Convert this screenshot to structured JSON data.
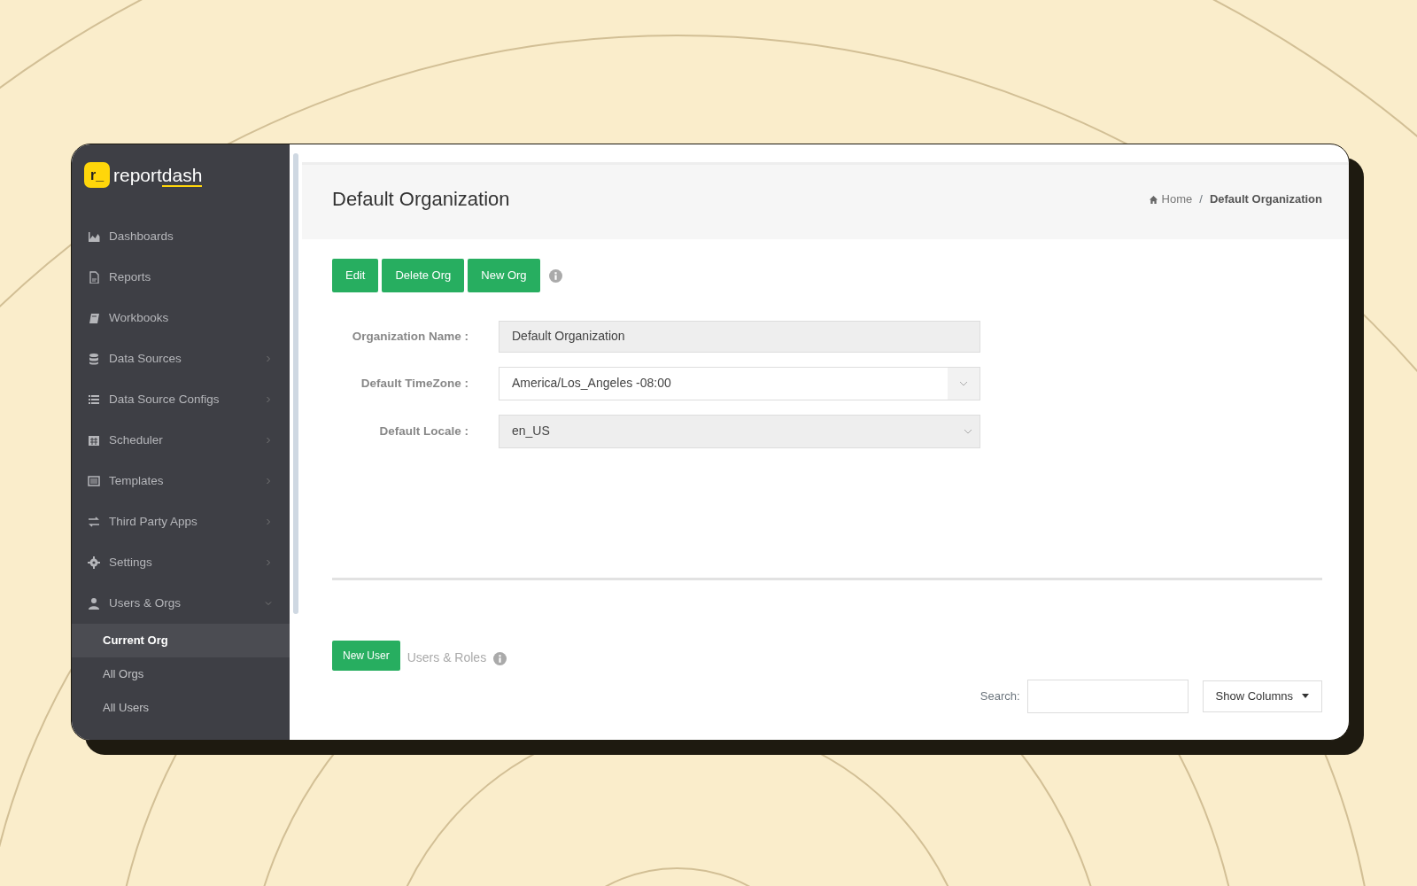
{
  "brand": {
    "mark": "r_",
    "name_start": "report",
    "name_end": "dash"
  },
  "sidebar": {
    "items": [
      {
        "label": "Dashboards",
        "kind": "link"
      },
      {
        "label": "Reports",
        "kind": "link"
      },
      {
        "label": "Workbooks",
        "kind": "link"
      },
      {
        "label": "Data Sources",
        "kind": "submenu",
        "expanded": false
      },
      {
        "label": "Data Source Configs",
        "kind": "submenu",
        "expanded": false
      },
      {
        "label": "Scheduler",
        "kind": "submenu",
        "expanded": false
      },
      {
        "label": "Templates",
        "kind": "submenu",
        "expanded": false
      },
      {
        "label": "Third Party Apps",
        "kind": "submenu",
        "expanded": false
      },
      {
        "label": "Settings",
        "kind": "submenu",
        "expanded": false
      },
      {
        "label": "Users & Orgs",
        "kind": "submenu",
        "expanded": true,
        "children": [
          {
            "label": "Current Org",
            "selected": true
          },
          {
            "label": "All Orgs",
            "selected": false
          },
          {
            "label": "All Users",
            "selected": false
          }
        ]
      }
    ]
  },
  "page": {
    "title": "Default Organization",
    "separator": "/",
    "breadcrumb": [
      {
        "label": "Home",
        "current": false
      },
      {
        "label": "Default Organization",
        "current": true
      }
    ]
  },
  "actions": [
    "Edit",
    "Delete Org",
    "New Org"
  ],
  "form": [
    {
      "label": "Organization Name :",
      "kind": "readonly",
      "value": "Default Organization"
    },
    {
      "label": "Default TimeZone :",
      "kind": "select",
      "value": "America/Los_Angeles -08:00"
    },
    {
      "label": "Default Locale :",
      "kind": "disabled-select",
      "value": "en_US"
    }
  ],
  "users": {
    "button": "New User",
    "heading": "Users & Roles",
    "search_label": "Search:",
    "columns_button": "Show Columns"
  }
}
